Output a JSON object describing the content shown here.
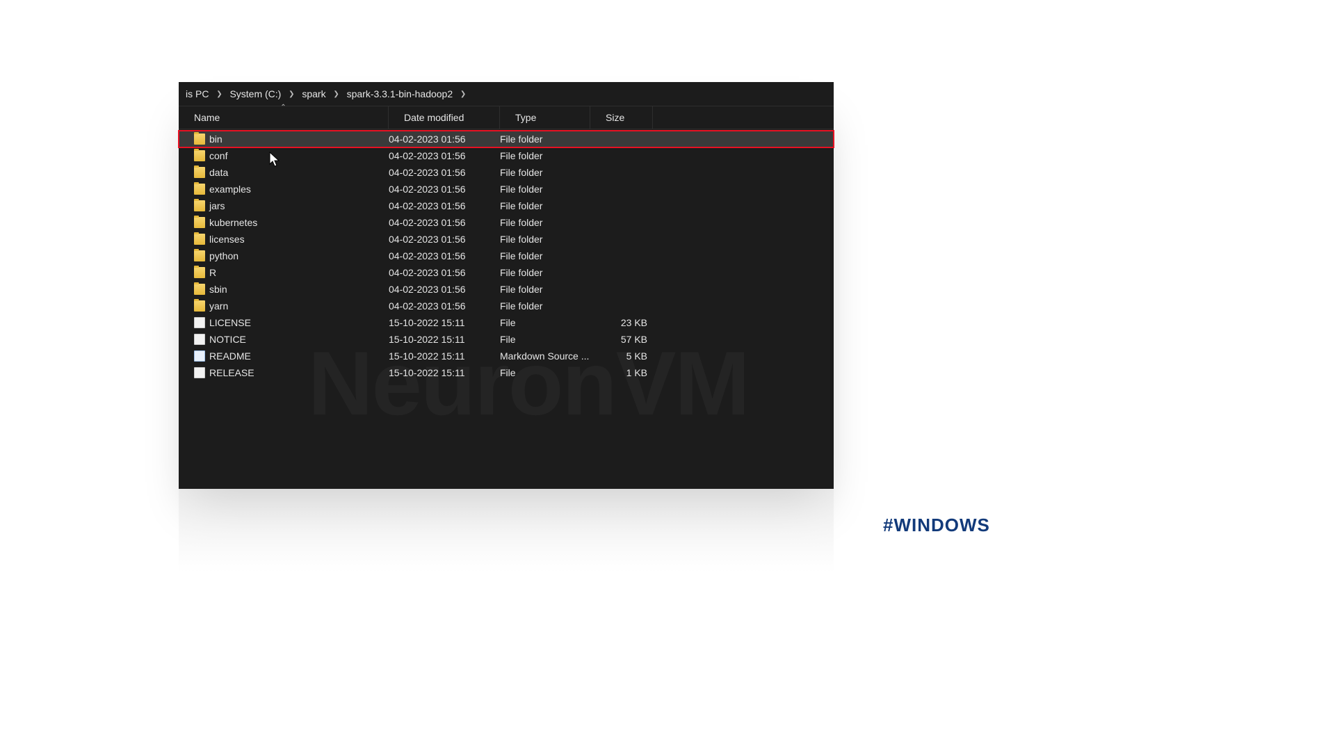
{
  "breadcrumb": [
    "is PC",
    "System (C:)",
    "spark",
    "spark-3.3.1-bin-hadoop2"
  ],
  "columns": {
    "name": "Name",
    "date": "Date modified",
    "type": "Type",
    "size": "Size"
  },
  "rows": [
    {
      "icon": "folder",
      "name": "bin",
      "date": "04-02-2023 01:56",
      "type": "File folder",
      "size": "",
      "selected": true,
      "highlighted": true
    },
    {
      "icon": "folder",
      "name": "conf",
      "date": "04-02-2023 01:56",
      "type": "File folder",
      "size": ""
    },
    {
      "icon": "folder",
      "name": "data",
      "date": "04-02-2023 01:56",
      "type": "File folder",
      "size": ""
    },
    {
      "icon": "folder",
      "name": "examples",
      "date": "04-02-2023 01:56",
      "type": "File folder",
      "size": ""
    },
    {
      "icon": "folder",
      "name": "jars",
      "date": "04-02-2023 01:56",
      "type": "File folder",
      "size": ""
    },
    {
      "icon": "folder",
      "name": "kubernetes",
      "date": "04-02-2023 01:56",
      "type": "File folder",
      "size": ""
    },
    {
      "icon": "folder",
      "name": "licenses",
      "date": "04-02-2023 01:56",
      "type": "File folder",
      "size": ""
    },
    {
      "icon": "folder",
      "name": "python",
      "date": "04-02-2023 01:56",
      "type": "File folder",
      "size": ""
    },
    {
      "icon": "folder",
      "name": "R",
      "date": "04-02-2023 01:56",
      "type": "File folder",
      "size": ""
    },
    {
      "icon": "folder",
      "name": "sbin",
      "date": "04-02-2023 01:56",
      "type": "File folder",
      "size": ""
    },
    {
      "icon": "folder",
      "name": "yarn",
      "date": "04-02-2023 01:56",
      "type": "File folder",
      "size": ""
    },
    {
      "icon": "file",
      "name": "LICENSE",
      "date": "15-10-2022 15:11",
      "type": "File",
      "size": "23 KB"
    },
    {
      "icon": "file",
      "name": "NOTICE",
      "date": "15-10-2022 15:11",
      "type": "File",
      "size": "57 KB"
    },
    {
      "icon": "file-md",
      "name": "README",
      "date": "15-10-2022 15:11",
      "type": "Markdown Source ...",
      "size": "5 KB"
    },
    {
      "icon": "file",
      "name": "RELEASE",
      "date": "15-10-2022 15:11",
      "type": "File",
      "size": "1 KB"
    }
  ],
  "watermark": "NeuronVM",
  "hashtag": "#WINDOWS"
}
